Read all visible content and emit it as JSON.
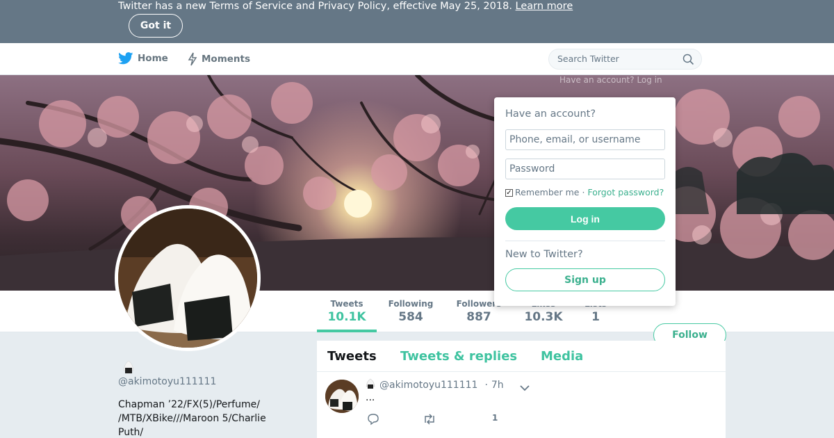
{
  "banner": {
    "text": "Twitter has a new Terms of Service and Privacy Policy, effective May 25, 2018.",
    "link": "Learn more",
    "button": "Got it"
  },
  "nav": {
    "home": "Home",
    "moments": "Moments",
    "search_placeholder": "Search Twitter",
    "home_icon": "bird-icon",
    "moments_icon": "lightning-icon",
    "search_icon": "search-icon"
  },
  "header": {
    "ghost_text": "Have an account? Log in"
  },
  "profile": {
    "handle": "@akimotoyu111111",
    "bio": "Chapman ’22/FX(5)/Perfume/ /MTB/XBike///Maroon 5/Charlie Puth/"
  },
  "stats": [
    {
      "label": "Tweets",
      "value": "10.1K",
      "active": true
    },
    {
      "label": "Following",
      "value": "584"
    },
    {
      "label": "Followers",
      "value": "887"
    },
    {
      "label": "Likes",
      "value": "10.3K"
    },
    {
      "label": "Lists",
      "value": "1"
    }
  ],
  "follow_button": "Follow",
  "tabs": [
    "Tweets",
    "Tweets & replies",
    "Media"
  ],
  "tweet": {
    "handle": "@akimotoyu111111",
    "separator": "·",
    "time": "7h",
    "text": "...",
    "like_count": "1"
  },
  "login": {
    "title": "Have an account?",
    "username_placeholder": "Phone, email, or username",
    "password_placeholder": "Password",
    "remember": "Remember me",
    "separator": "·",
    "forgot": "Forgot password?",
    "login_button": "Log in",
    "new_title": "New to Twitter?",
    "signup_button": "Sign up"
  },
  "colors": {
    "accent": "#45c9a2",
    "banner_bg": "#657786",
    "link_blue": "#1da1f2"
  }
}
